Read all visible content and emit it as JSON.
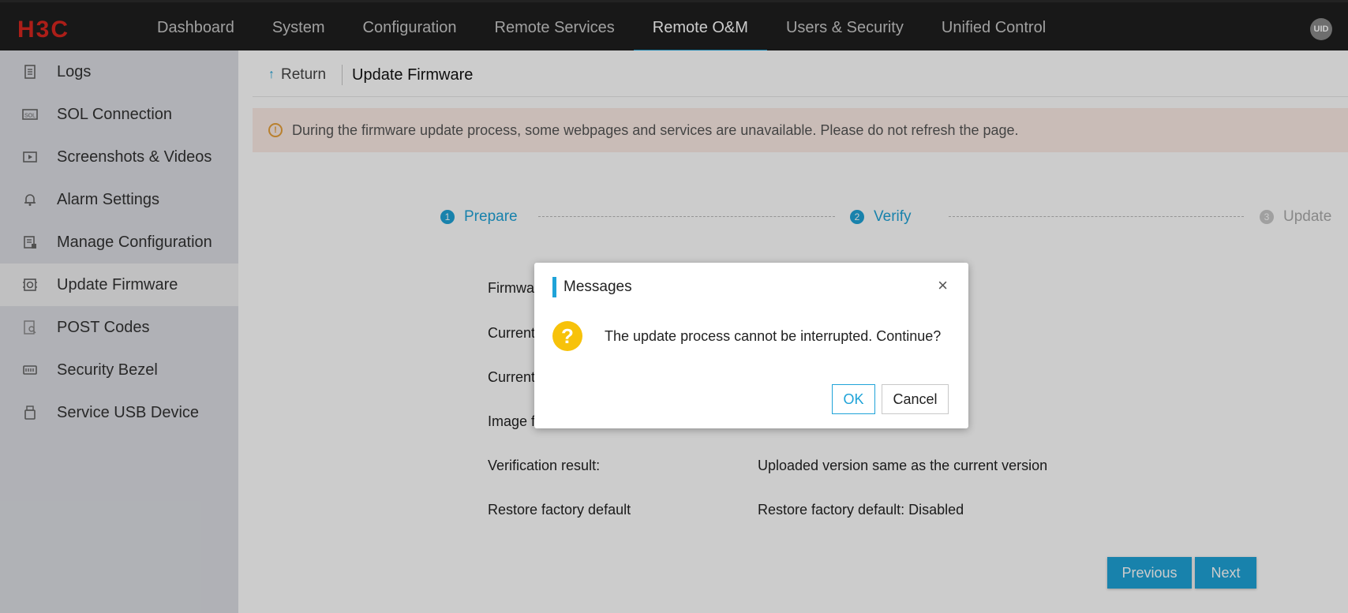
{
  "brand": {
    "logo_text": "H3C",
    "logo_color": "#d7261f"
  },
  "nav": {
    "items": [
      {
        "label": "Dashboard"
      },
      {
        "label": "System"
      },
      {
        "label": "Configuration"
      },
      {
        "label": "Remote Services"
      },
      {
        "label": "Remote O&M",
        "active": true
      },
      {
        "label": "Users & Security"
      },
      {
        "label": "Unified Control"
      }
    ],
    "uid_label": "UID"
  },
  "sidebar": {
    "items": [
      {
        "label": "Logs",
        "icon": "log-icon"
      },
      {
        "label": "SOL Connection",
        "icon": "sol-icon"
      },
      {
        "label": "Screenshots & Videos",
        "icon": "video-icon"
      },
      {
        "label": "Alarm Settings",
        "icon": "bell-icon"
      },
      {
        "label": "Manage Configuration",
        "icon": "config-icon"
      },
      {
        "label": "Update Firmware",
        "icon": "firmware-icon",
        "active": true
      },
      {
        "label": "POST Codes",
        "icon": "post-icon"
      },
      {
        "label": "Security Bezel",
        "icon": "bezel-icon"
      },
      {
        "label": "Service USB Device",
        "icon": "usb-icon"
      }
    ]
  },
  "breadcrumb": {
    "return_label": "Return",
    "title": "Update Firmware"
  },
  "notice": {
    "text": "During the firmware update process, some webpages and services are unavailable. Please do not refresh the page."
  },
  "steps": [
    {
      "num": "1",
      "label": "Prepare",
      "state": "done"
    },
    {
      "num": "2",
      "label": "Verify",
      "state": "done"
    },
    {
      "num": "3",
      "label": "Update",
      "state": "todo"
    }
  ],
  "info": {
    "rows": [
      {
        "label": "Firmwa",
        "value": ""
      },
      {
        "label": "Current",
        "value": ""
      },
      {
        "label": "Current",
        "value": ""
      },
      {
        "label": "Image f",
        "value": ""
      },
      {
        "label": "Verification result:",
        "value": "Uploaded version same as the current version"
      },
      {
        "label": "Restore factory default",
        "value": "Restore factory default: Disabled"
      }
    ]
  },
  "actions": {
    "previous_label": "Previous",
    "next_label": "Next"
  },
  "modal": {
    "title": "Messages",
    "close_glyph": "×",
    "icon_glyph": "?",
    "message": "The update process cannot be interrupted. Continue?",
    "ok_label": "OK",
    "cancel_label": "Cancel"
  },
  "colors": {
    "accent": "#1fa3d8",
    "topbar": "#1f1f1f",
    "notice_bg": "#fcece5",
    "warning": "#f7c20a"
  }
}
